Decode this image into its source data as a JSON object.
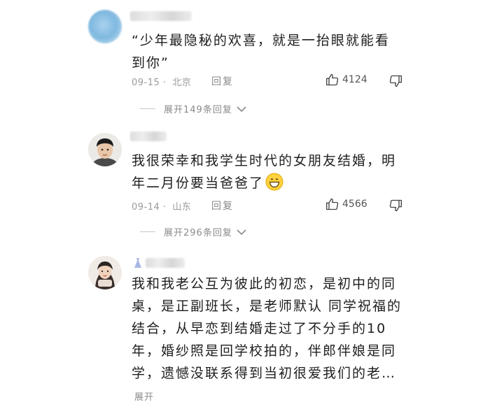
{
  "comments": [
    {
      "text": "“少年最隐秘的欢喜，就是一抬眼就能看到你”",
      "date": "09-15",
      "location": "北京",
      "reply_label": "回复",
      "likes": "4124",
      "expand_label": "展开149条回复"
    },
    {
      "text": "我很荣幸和我学生时代的女朋友结婚，明年二月份要当爸爸了",
      "emoji": "grinning-face",
      "date": "09-14",
      "location": "山东",
      "reply_label": "回复",
      "likes": "4566",
      "expand_label": "展开296条回复"
    },
    {
      "text": "我和我老公互为彼此的初恋，是初中的同桌，是正副班长，是老师默认 同学祝福的结合，从早恋到结婚走过了不分手的10年，婚纱照是回学校拍的，伴郎伴娘是同学，遗憾没联系得到当初很爱我们的老…",
      "more_label": "展开"
    }
  ],
  "icons": {
    "like": "thumbs-up-icon",
    "dislike": "thumbs-down-icon",
    "expand": "chevron-down-icon"
  }
}
